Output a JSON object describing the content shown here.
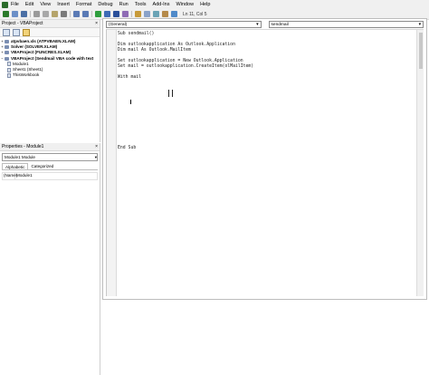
{
  "menu": [
    "File",
    "Edit",
    "View",
    "Insert",
    "Format",
    "Debug",
    "Run",
    "Tools",
    "Add-Ins",
    "Window",
    "Help"
  ],
  "toolbar": {
    "status": "Ln 11, Col 5"
  },
  "project_panel": {
    "title": "Project - VBAProject",
    "close": "×",
    "items": [
      {
        "label": "atpvbaen.xls (ATPVBAEN.XLAM)",
        "level": 0,
        "exp": "+"
      },
      {
        "label": "Solver (SOLVER.XLAM)",
        "level": 0,
        "exp": "+"
      },
      {
        "label": "VBAProject (FUNCRES.XLAM)",
        "level": 0,
        "exp": "+"
      },
      {
        "label": "VBAProject (Sendmail VBA code with text",
        "level": 0,
        "exp": "−"
      },
      {
        "label": "Module1",
        "level": 1,
        "exp": ""
      },
      {
        "label": "Sheet1 (Sheet1)",
        "level": 1,
        "exp": ""
      },
      {
        "label": "ThisWorkbook",
        "level": 1,
        "exp": ""
      }
    ]
  },
  "properties_panel": {
    "title": "Properties - Module1",
    "close": "×",
    "object": "Module1 Module",
    "tabs": [
      "Alphabetic",
      "Categorized"
    ],
    "row_key": "(Name)",
    "row_value": "Module1"
  },
  "code_window": {
    "object_combo": "(General)",
    "proc_combo": "sendmail",
    "lines": [
      "Sub sendmail()",
      "",
      "Dim outlookapplication As Outlook.Application",
      "Dim mail As Outlook.MailItem",
      "",
      "Set outlookapplication = New Outlook.Application",
      "Set mail = outlookapplication.CreateItem(olMailItem)",
      "",
      "With mail",
      "",
      "",
      "",
      "",
      "",
      "",
      "",
      "",
      "",
      "",
      "",
      "",
      "End Sub"
    ]
  },
  "colors": {
    "toolbar_bg": "#f0f0f0",
    "code_text": "#1a1a1a"
  }
}
